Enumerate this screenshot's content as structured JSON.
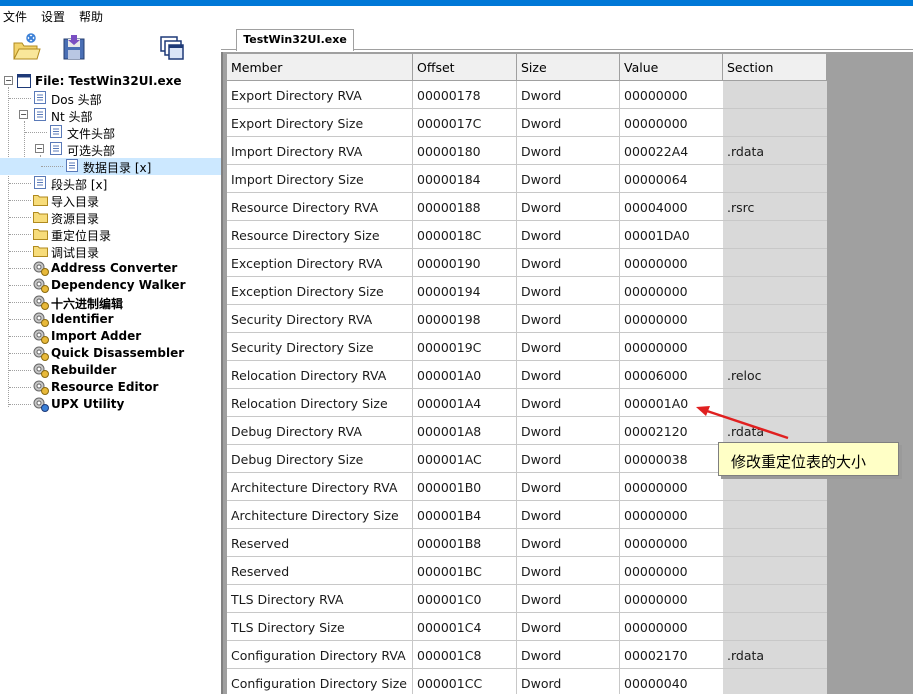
{
  "menu": [
    "文件",
    "设置",
    "帮助"
  ],
  "toolbar": {
    "icons": [
      "open-file-icon",
      "save-icon",
      "windows-icon"
    ]
  },
  "tree": {
    "root": "File: TestWin32UI.exe",
    "items": [
      {
        "label": "Dos 头部",
        "icon": "document-icon"
      },
      {
        "label": "Nt 头部",
        "icon": "document-icon"
      },
      {
        "label": "文件头部",
        "icon": "document-icon"
      },
      {
        "label": "可选头部",
        "icon": "document-icon"
      },
      {
        "label": "数据目录 [x]",
        "icon": "document-icon"
      },
      {
        "label": "段头部 [x]",
        "icon": "document-icon"
      },
      {
        "label": "导入目录",
        "icon": "folder-icon"
      },
      {
        "label": "资源目录",
        "icon": "folder-icon"
      },
      {
        "label": "重定位目录",
        "icon": "folder-icon"
      },
      {
        "label": "调试目录",
        "icon": "folder-icon"
      },
      {
        "label": "Address Converter",
        "icon": "tool-icon"
      },
      {
        "label": "Dependency Walker",
        "icon": "tool-icon"
      },
      {
        "label": "十六进制编辑",
        "icon": "tool-icon"
      },
      {
        "label": "Identifier",
        "icon": "tool-icon"
      },
      {
        "label": "Import Adder",
        "icon": "tool-icon"
      },
      {
        "label": "Quick Disassembler",
        "icon": "tool-icon"
      },
      {
        "label": "Rebuilder",
        "icon": "tool-icon"
      },
      {
        "label": "Resource Editor",
        "icon": "tool-icon"
      },
      {
        "label": "UPX Utility",
        "icon": "globe-tool-icon"
      }
    ]
  },
  "tab": {
    "label": "TestWin32UI.exe"
  },
  "table": {
    "columns": [
      "Member",
      "Offset",
      "Size",
      "Value",
      "Section"
    ],
    "rows": [
      [
        "Export Directory RVA",
        "00000178",
        "Dword",
        "00000000",
        ""
      ],
      [
        "Export Directory Size",
        "0000017C",
        "Dword",
        "00000000",
        ""
      ],
      [
        "Import Directory RVA",
        "00000180",
        "Dword",
        "000022A4",
        ".rdata"
      ],
      [
        "Import Directory Size",
        "00000184",
        "Dword",
        "00000064",
        ""
      ],
      [
        "Resource Directory RVA",
        "00000188",
        "Dword",
        "00004000",
        ".rsrc"
      ],
      [
        "Resource Directory Size",
        "0000018C",
        "Dword",
        "00001DA0",
        ""
      ],
      [
        "Exception Directory RVA",
        "00000190",
        "Dword",
        "00000000",
        ""
      ],
      [
        "Exception Directory Size",
        "00000194",
        "Dword",
        "00000000",
        ""
      ],
      [
        "Security Directory RVA",
        "00000198",
        "Dword",
        "00000000",
        ""
      ],
      [
        "Security Directory Size",
        "0000019C",
        "Dword",
        "00000000",
        ""
      ],
      [
        "Relocation Directory RVA",
        "000001A0",
        "Dword",
        "00006000",
        ".reloc"
      ],
      [
        "Relocation Directory Size",
        "000001A4",
        "Dword",
        "000001A0",
        ""
      ],
      [
        "Debug Directory RVA",
        "000001A8",
        "Dword",
        "00002120",
        ".rdata"
      ],
      [
        "Debug Directory Size",
        "000001AC",
        "Dword",
        "00000038",
        ""
      ],
      [
        "Architecture Directory RVA",
        "000001B0",
        "Dword",
        "00000000",
        ""
      ],
      [
        "Architecture Directory Size",
        "000001B4",
        "Dword",
        "00000000",
        ""
      ],
      [
        "Reserved",
        "000001B8",
        "Dword",
        "00000000",
        ""
      ],
      [
        "Reserved",
        "000001BC",
        "Dword",
        "00000000",
        ""
      ],
      [
        "TLS Directory RVA",
        "000001C0",
        "Dword",
        "00000000",
        ""
      ],
      [
        "TLS Directory Size",
        "000001C4",
        "Dword",
        "00000000",
        ""
      ],
      [
        "Configuration Directory RVA",
        "000001C8",
        "Dword",
        "00002170",
        ".rdata"
      ],
      [
        "Configuration Directory Size",
        "000001CC",
        "Dword",
        "00000040",
        ""
      ]
    ]
  },
  "annotation": {
    "text": "修改重定位表的大小"
  },
  "colors": {
    "accent": "#0078d7",
    "selection": "#cce8ff",
    "callout": "#ffffc6",
    "arrow": "#e02020"
  }
}
